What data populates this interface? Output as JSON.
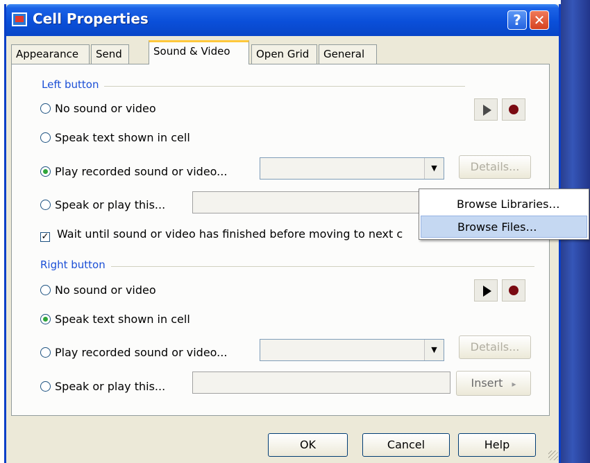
{
  "window": {
    "title": "Cell Properties",
    "help_glyph": "?",
    "close_glyph": "✕"
  },
  "tabs": [
    {
      "label": "Appearance"
    },
    {
      "label": "Send"
    },
    {
      "label": "Sound & Video",
      "active": true
    },
    {
      "label": "Open Grid"
    },
    {
      "label": "General"
    }
  ],
  "left_button": {
    "group_label": "Left button",
    "options": [
      {
        "label": "No sound or video",
        "selected": false
      },
      {
        "label": "Speak text shown in cell",
        "selected": false
      },
      {
        "label": "Play recorded sound or video...",
        "selected": true
      },
      {
        "label": "Speak or play this...",
        "selected": false
      }
    ],
    "details_label": "Details...",
    "wait_checkbox": {
      "label": "Wait until sound or video has finished before moving to next c",
      "checked": true,
      "glyph": "✓"
    }
  },
  "right_button": {
    "group_label": "Right button",
    "options": [
      {
        "label": "No sound or video",
        "selected": false
      },
      {
        "label": "Speak text shown in cell",
        "selected": true
      },
      {
        "label": "Play recorded sound or video...",
        "selected": false
      },
      {
        "label": "Speak or play this...",
        "selected": false
      }
    ],
    "details_label": "Details...",
    "insert_label": "Insert",
    "insert_arrow": "▸"
  },
  "context_menu": {
    "items": [
      {
        "label": "Browse Libraries…",
        "highlighted": false
      },
      {
        "label": "Browse Files…",
        "highlighted": true
      }
    ]
  },
  "footer": {
    "ok_label": "OK",
    "cancel_label": "Cancel",
    "help_label": "Help"
  },
  "icons": {
    "dropdown_arrow": "▼"
  },
  "colors": {
    "accent_label": "#1b4fd6",
    "record": "#7a0a12",
    "titlebar": "#0a4fd9",
    "highlight": "#c5d8f2"
  }
}
